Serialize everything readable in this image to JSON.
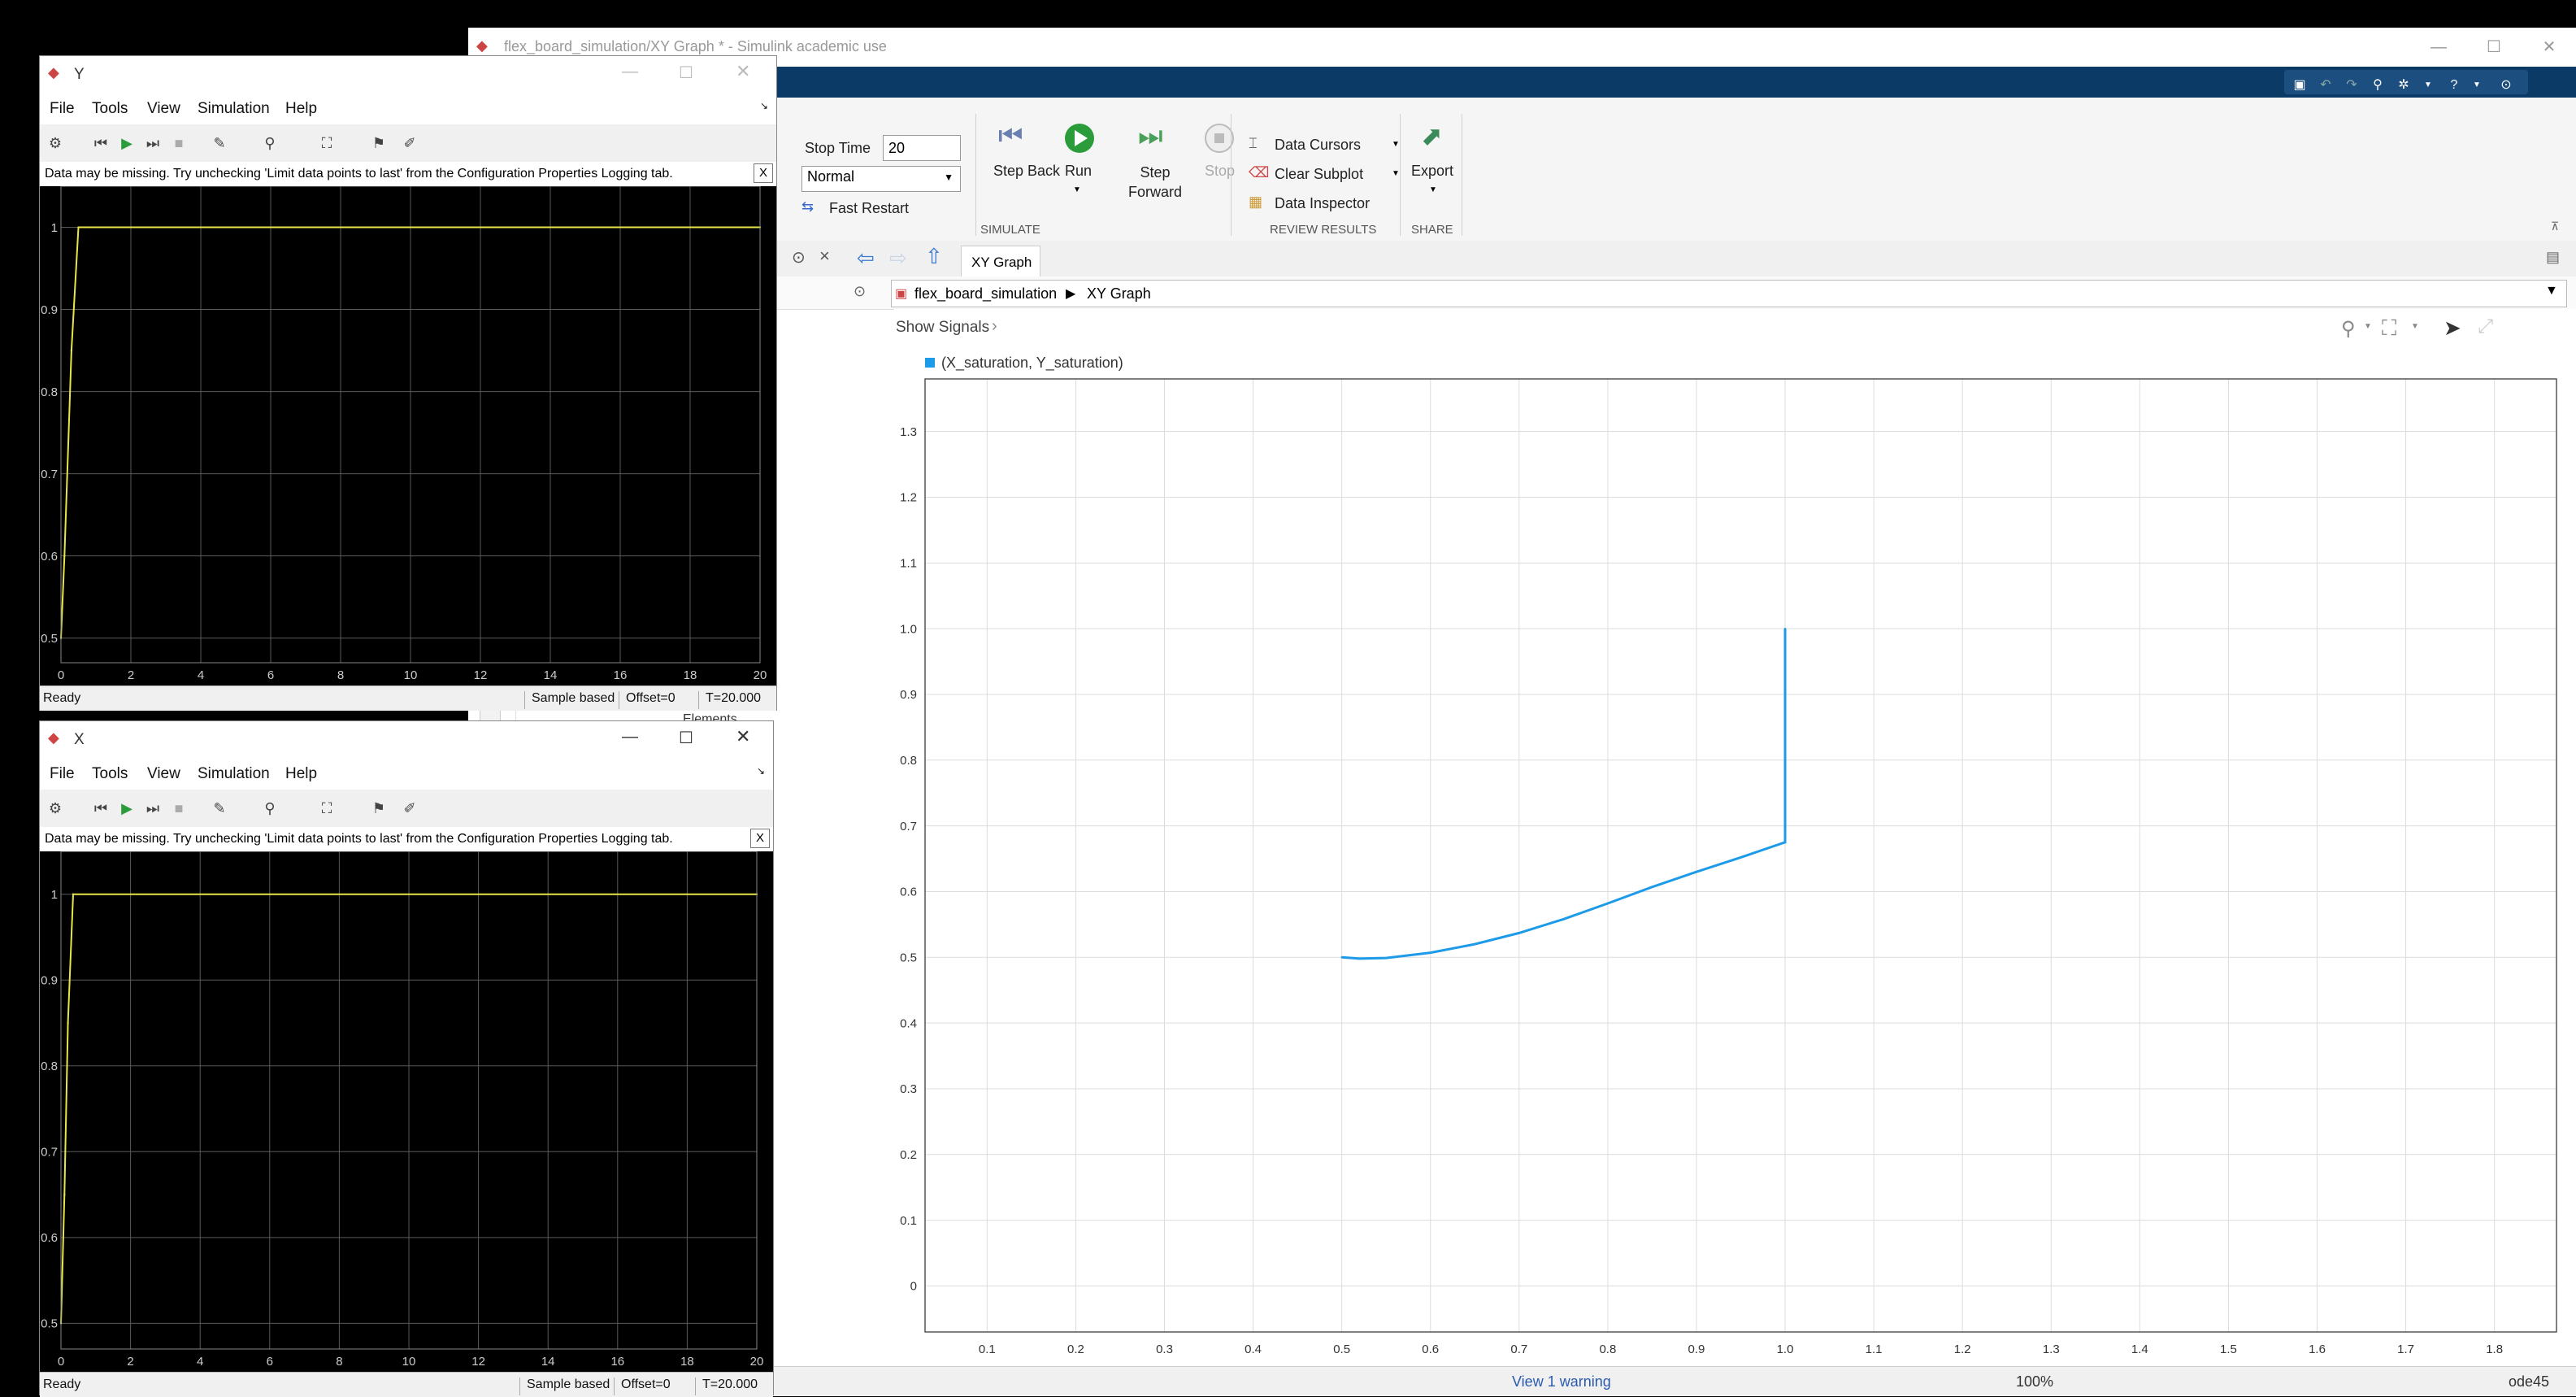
{
  "simulink": {
    "window_title": "flex_board_simulation/XY Graph * - Simulink academic use",
    "ribbon": {
      "stop_time_label": "Stop Time",
      "stop_time_value": "20",
      "sim_mode": "Normal",
      "fast_restart": "Fast Restart",
      "step_back": "Step Back",
      "run": "Run",
      "step_forward": "Step Forward",
      "stop": "Stop",
      "simulate_group": "SIMULATE",
      "data_cursors": "Data Cursors",
      "clear_subplot": "Clear Subplot",
      "data_inspector": "Data Inspector",
      "review_group": "REVIEW RESULTS",
      "export": "Export",
      "share_group": "SHARE"
    },
    "tab_label": "XY Graph",
    "breadcrumb": {
      "model": "flex_board_simulation",
      "block": "XY Graph"
    },
    "show_signals": "Show Signals",
    "status": {
      "warning": "View 1 warning",
      "zoom": "100%",
      "solver": "ode45"
    },
    "colors": {
      "quickbar": "#0c3a66",
      "series": "#1e9be8"
    }
  },
  "scope_y": {
    "title": "Y",
    "menu": [
      "File",
      "Tools",
      "View",
      "Simulation",
      "Help"
    ],
    "warning": "Data may be missing.  Try unchecking 'Limit data points to last' from the Configuration Properties Logging tab.",
    "close_x": "X",
    "status_ready": "Ready",
    "sample_based": "Sample based",
    "offset": "Offset=0",
    "time": "T=20.000"
  },
  "scope_x": {
    "title": "X",
    "menu": [
      "File",
      "Tools",
      "View",
      "Simulation",
      "Help"
    ],
    "warning": "Data may be missing.  Try unchecking 'Limit data points to last' from the Configuration Properties Logging tab.",
    "close_x": "X",
    "status_ready": "Ready",
    "sample_based": "Sample based",
    "offset": "Offset=0",
    "time": "T=20.000"
  },
  "partial_text": "Elements",
  "chart_data": [
    {
      "id": "xy",
      "type": "line",
      "legend": "(X_saturation, Y_saturation)",
      "xlim": [
        0.03,
        1.87
      ],
      "ylim": [
        -0.07,
        1.38
      ],
      "xticks": [
        "0.1",
        "0.2",
        "0.3",
        "0.4",
        "0.5",
        "0.6",
        "0.7",
        "0.8",
        "0.9",
        "1.0",
        "1.1",
        "1.2",
        "1.3",
        "1.4",
        "1.5",
        "1.6",
        "1.7",
        "1.8"
      ],
      "yticks": [
        "0",
        "0.1",
        "0.2",
        "0.3",
        "0.4",
        "0.5",
        "0.6",
        "0.7",
        "0.8",
        "0.9",
        "1.0",
        "1.1",
        "1.2",
        "1.3"
      ],
      "grid": true,
      "background": "#ffffff",
      "line_color": "#1e9be8",
      "x": [
        0.5,
        0.52,
        0.55,
        0.6,
        0.65,
        0.7,
        0.75,
        0.8,
        0.85,
        0.9,
        0.95,
        1.0,
        1.0
      ],
      "y": [
        0.5,
        0.498,
        0.499,
        0.507,
        0.52,
        0.537,
        0.558,
        0.582,
        0.607,
        0.63,
        0.652,
        0.675,
        1.0
      ]
    },
    {
      "id": "scope_y",
      "type": "line",
      "xlim": [
        0,
        20
      ],
      "ylim": [
        0.47,
        1.05
      ],
      "xticks": [
        "0",
        "2",
        "4",
        "6",
        "8",
        "10",
        "12",
        "14",
        "16",
        "18",
        "20"
      ],
      "yticks": [
        "0.5",
        "0.6",
        "0.7",
        "0.8",
        "0.9",
        "1"
      ],
      "grid": true,
      "background": "#000000",
      "line_color": "#e6e64a",
      "x": [
        0,
        0.1,
        0.3,
        0.5,
        20
      ],
      "y": [
        0.5,
        0.6,
        0.85,
        1.0,
        1.0
      ]
    },
    {
      "id": "scope_x",
      "type": "line",
      "xlim": [
        0,
        20
      ],
      "ylim": [
        0.47,
        1.05
      ],
      "xticks": [
        "0",
        "2",
        "4",
        "6",
        "8",
        "10",
        "12",
        "14",
        "16",
        "18",
        "20"
      ],
      "yticks": [
        "0.5",
        "0.6",
        "0.7",
        "0.8",
        "0.9",
        "1"
      ],
      "grid": true,
      "background": "#000000",
      "line_color": "#e6e64a",
      "x": [
        0,
        0.1,
        0.2,
        0.35,
        20
      ],
      "y": [
        0.5,
        0.65,
        0.85,
        1.0,
        1.0
      ]
    }
  ]
}
